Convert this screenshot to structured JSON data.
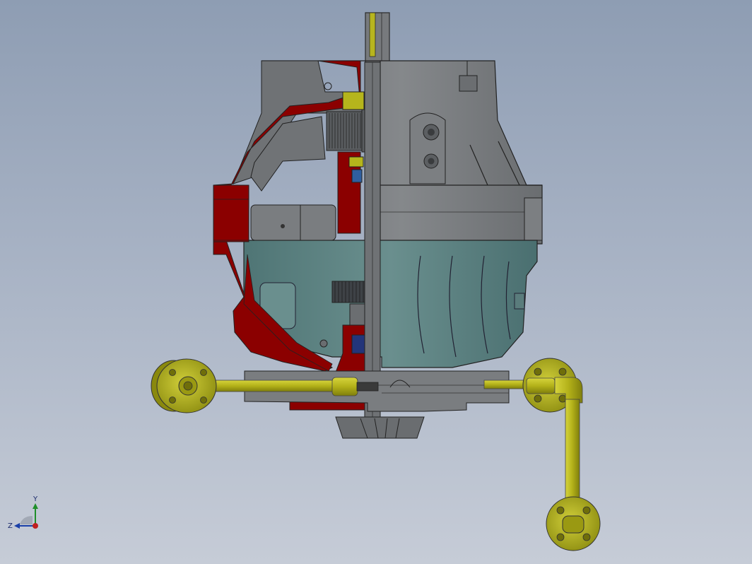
{
  "viewport": {
    "background_top": "#8e9db3",
    "background_bottom": "#c6ccd7"
  },
  "model": {
    "section_color": "#8b0000",
    "body_grey": "#7a7d80",
    "lower_housing": "#5f8585",
    "pipe_color": "#b5b51c",
    "gear_color": "#3e4246"
  },
  "triad": {
    "y_label": "Y",
    "z_label": "Z"
  }
}
